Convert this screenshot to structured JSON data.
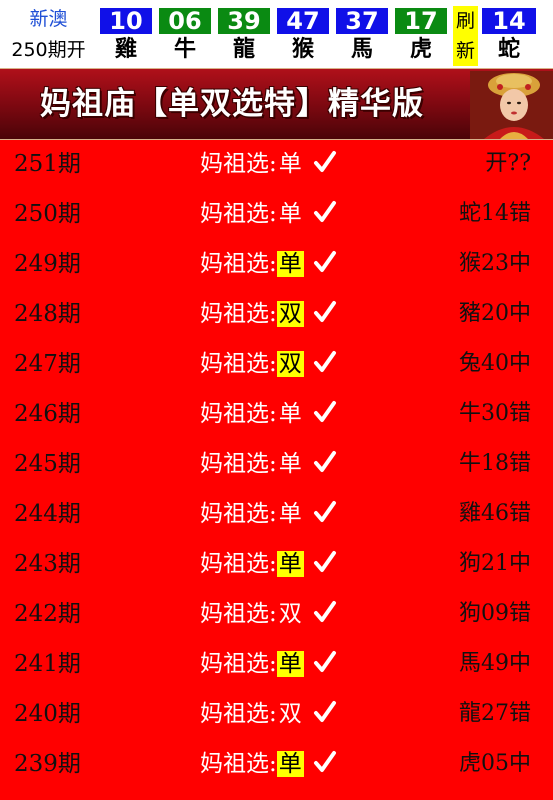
{
  "header": {
    "region_label": "新澳",
    "period_label": "250期开",
    "balls": [
      {
        "number": "10",
        "zodiac": "雞",
        "color": "blue"
      },
      {
        "number": "06",
        "zodiac": "牛",
        "color": "green"
      },
      {
        "number": "39",
        "zodiac": "龍",
        "color": "green"
      },
      {
        "number": "47",
        "zodiac": "猴",
        "color": "blue"
      },
      {
        "number": "37",
        "zodiac": "馬",
        "color": "blue"
      },
      {
        "number": "17",
        "zodiac": "虎",
        "color": "green"
      }
    ],
    "refresh_top": "刷",
    "refresh_bottom": "新",
    "special_ball": {
      "number": "14",
      "zodiac": "蛇",
      "color": "blue"
    }
  },
  "banner": {
    "title": "妈祖庙【单双选特】精华版"
  },
  "rows": [
    {
      "period": "251期",
      "label": "妈祖选",
      "colon": ":",
      "value": "单",
      "highlight": false,
      "result": "开??"
    },
    {
      "period": "250期",
      "label": "妈祖选",
      "colon": ":",
      "value": "单",
      "highlight": false,
      "result": "蛇14错"
    },
    {
      "period": "249期",
      "label": "妈祖选",
      "colon": ":",
      "value": "单",
      "highlight": true,
      "result": "猴23中"
    },
    {
      "period": "248期",
      "label": "妈祖选",
      "colon": ":",
      "value": "双",
      "highlight": true,
      "result": "豬20中"
    },
    {
      "period": "247期",
      "label": "妈祖选",
      "colon": ":",
      "value": "双",
      "highlight": true,
      "result": "兔40中"
    },
    {
      "period": "246期",
      "label": "妈祖选",
      "colon": ":",
      "value": "单",
      "highlight": false,
      "result": "牛30错"
    },
    {
      "period": "245期",
      "label": "妈祖选",
      "colon": ":",
      "value": "单",
      "highlight": false,
      "result": "牛18错"
    },
    {
      "period": "244期",
      "label": "妈祖选",
      "colon": ":",
      "value": "单",
      "highlight": false,
      "result": "雞46错"
    },
    {
      "period": "243期",
      "label": "妈祖选",
      "colon": ":",
      "value": "单",
      "highlight": true,
      "result": "狗21中"
    },
    {
      "period": "242期",
      "label": "妈祖选",
      "colon": ":",
      "value": "双",
      "highlight": false,
      "result": "狗09错"
    },
    {
      "period": "241期",
      "label": "妈祖选",
      "colon": ":",
      "value": "单",
      "highlight": true,
      "result": "馬49中"
    },
    {
      "period": "240期",
      "label": "妈祖选",
      "colon": ":",
      "value": "双",
      "highlight": false,
      "result": "龍27错"
    },
    {
      "period": "239期",
      "label": "妈祖选",
      "colon": ":",
      "value": "单",
      "highlight": true,
      "result": "虎05中"
    }
  ],
  "colors": {
    "page_background": "#ff0000",
    "ball_blue": "#1010e8",
    "ball_green": "#0a8a12",
    "highlight": "#ffff00",
    "banner_dark": "#7a0810"
  }
}
